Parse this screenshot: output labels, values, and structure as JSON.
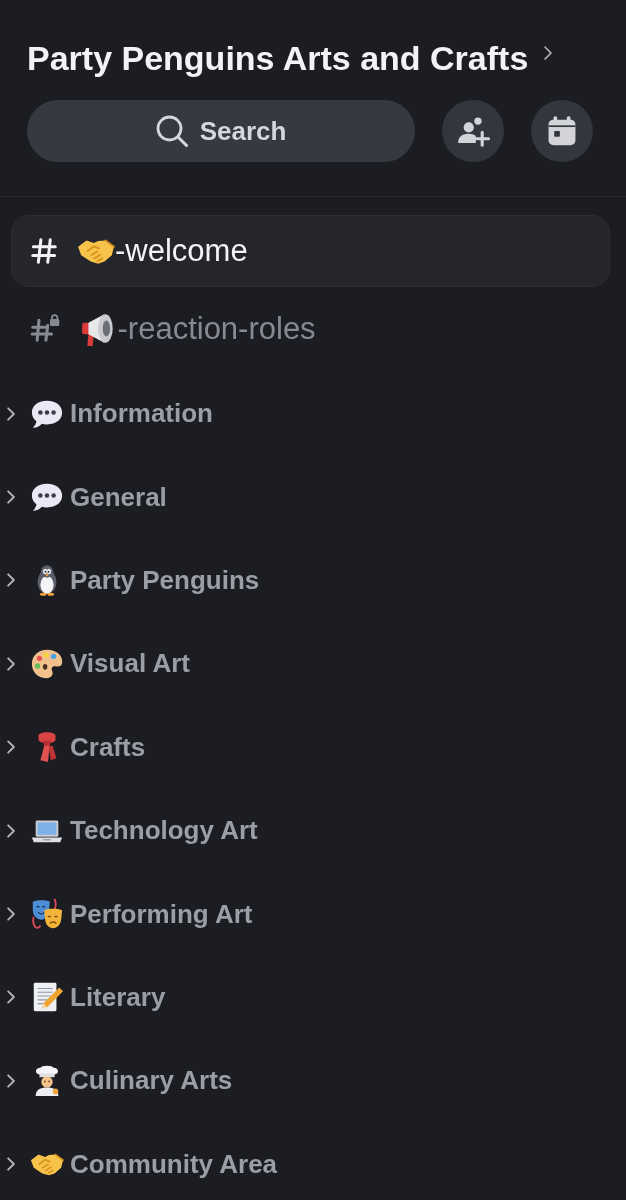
{
  "server": {
    "name": "Party Penguins Arts and Crafts"
  },
  "search_button": {
    "label": "Search"
  },
  "channels": [
    {
      "kind": "handshake",
      "name": "-welcome",
      "locked": false,
      "selected": true
    },
    {
      "kind": "megaphone",
      "name": "-reaction-roles",
      "locked": true,
      "selected": false
    }
  ],
  "categories": [
    {
      "kind": "speech",
      "name": "Information",
      "expanded": false
    },
    {
      "kind": "speech",
      "name": "General",
      "expanded": false
    },
    {
      "kind": "penguin",
      "name": "Party Penguins",
      "expanded": false
    },
    {
      "kind": "palette",
      "name": "Visual Art",
      "expanded": false
    },
    {
      "kind": "scarf",
      "name": "Crafts",
      "expanded": false
    },
    {
      "kind": "laptop",
      "name": "Technology Art",
      "expanded": false
    },
    {
      "kind": "masks",
      "name": "Performing Art",
      "expanded": false
    },
    {
      "kind": "memo",
      "name": "Literary",
      "expanded": false
    },
    {
      "kind": "cook",
      "name": "Culinary Arts",
      "expanded": false
    },
    {
      "kind": "handshake",
      "name": "Community Area",
      "expanded": false
    }
  ]
}
